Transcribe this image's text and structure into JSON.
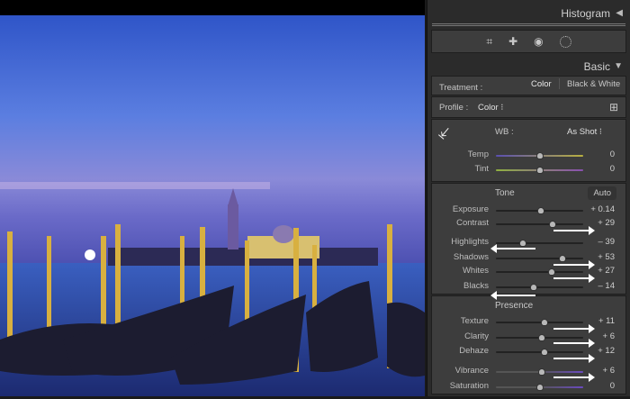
{
  "panel": {
    "histogram_title": "Histogram",
    "tools": [
      "crop-icon",
      "heal-icon",
      "redeye-icon",
      "mask-icon"
    ],
    "basic_title": "Basic",
    "treatment": {
      "label": "Treatment :",
      "options": [
        "Color",
        "Black & White"
      ],
      "selected": "Color"
    },
    "profile": {
      "label": "Profile :",
      "value": "Color"
    },
    "wb": {
      "label": "WB :",
      "value": "As Shot"
    },
    "wb_sliders": [
      {
        "label": "Temp",
        "value": "0",
        "num": 0,
        "min": -100,
        "max": 100
      },
      {
        "label": "Tint",
        "value": "0",
        "num": 0,
        "min": -100,
        "max": 100
      }
    ],
    "tone": {
      "title": "Tone",
      "auto": "Auto"
    },
    "tone_sliders": [
      {
        "label": "Exposure",
        "value": "+ 0.14",
        "num": 0.14,
        "min": -5,
        "max": 5
      },
      {
        "label": "Contrast",
        "value": "+ 29",
        "num": 29,
        "min": -100,
        "max": 100
      },
      {
        "label": "Highlights",
        "value": "– 39",
        "num": -39,
        "min": -100,
        "max": 100
      },
      {
        "label": "Shadows",
        "value": "+ 53",
        "num": 53,
        "min": -100,
        "max": 100
      },
      {
        "label": "Whites",
        "value": "+ 27",
        "num": 27,
        "min": -100,
        "max": 100
      },
      {
        "label": "Blacks",
        "value": "– 14",
        "num": -14,
        "min": -100,
        "max": 100
      }
    ],
    "presence": {
      "title": "Presence"
    },
    "presence_sliders": [
      {
        "label": "Texture",
        "value": "+ 11",
        "num": 11,
        "min": -100,
        "max": 100
      },
      {
        "label": "Clarity",
        "value": "+ 6",
        "num": 6,
        "min": -100,
        "max": 100
      },
      {
        "label": "Dehaze",
        "value": "+ 12",
        "num": 12,
        "min": -100,
        "max": 100
      },
      {
        "label": "Vibrance",
        "value": "+ 6",
        "num": 6,
        "min": -100,
        "max": 100
      },
      {
        "label": "Saturation",
        "value": "0",
        "num": 0,
        "min": -100,
        "max": 100
      }
    ]
  }
}
